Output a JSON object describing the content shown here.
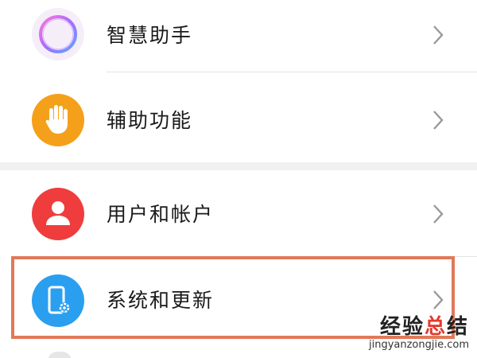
{
  "settings": {
    "items": [
      {
        "label": "智慧助手",
        "icon": "assistant-ring-icon"
      },
      {
        "label": "辅助功能",
        "icon": "hand-icon"
      },
      {
        "label": "用户和帐户",
        "icon": "user-icon"
      },
      {
        "label": "系统和更新",
        "icon": "phone-gear-icon"
      }
    ]
  },
  "colors": {
    "accessibility": "#f5a01a",
    "users": "#ef3d3d",
    "system": "#2a9ff0",
    "highlight": "#e0795a"
  },
  "watermark": {
    "main_part1": "经验",
    "main_accent": "总",
    "main_part2": "结",
    "sub": "jingyanzongjie.com"
  }
}
